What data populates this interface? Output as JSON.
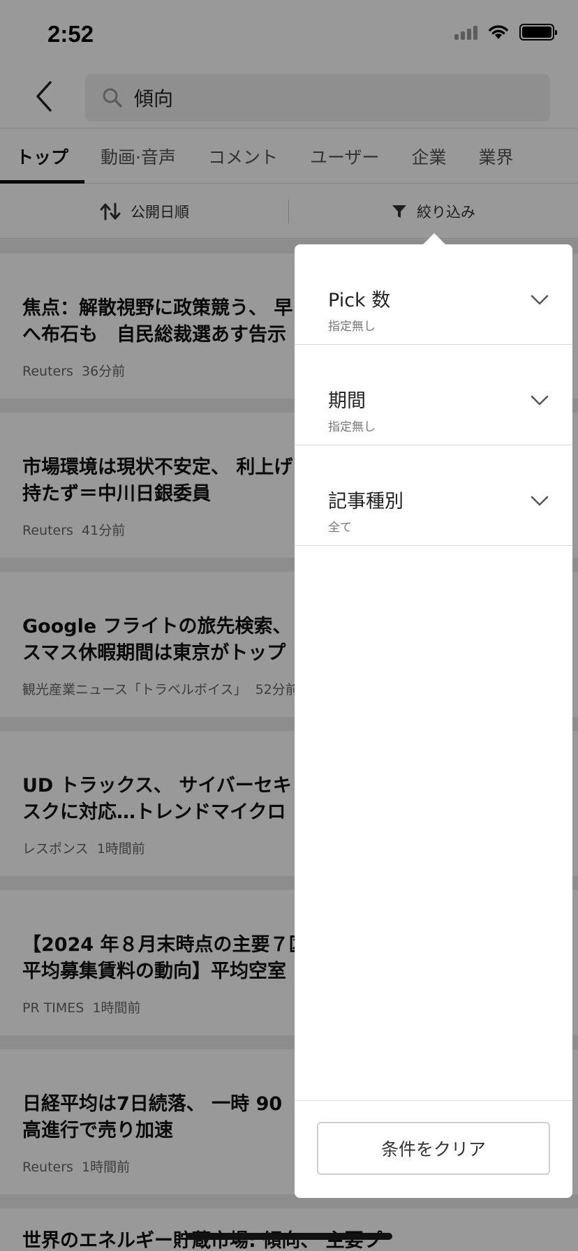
{
  "status_bar": {
    "time": "2:52"
  },
  "search": {
    "query": "傾向"
  },
  "tabs": [
    {
      "label": "トップ",
      "active": true
    },
    {
      "label": "動画·音声",
      "active": false
    },
    {
      "label": "コメント",
      "active": false
    },
    {
      "label": "ユーザー",
      "active": false
    },
    {
      "label": "企業",
      "active": false
    },
    {
      "label": "業界",
      "active": false
    }
  ],
  "sort_bar": {
    "sort_label": "公開日順",
    "filter_label": "絞り込み"
  },
  "articles": [
    {
      "title": "焦点：解散視野に政策競う、 早\nへ布石も　自民総裁選あす告示",
      "source": "Reuters",
      "time": "36分前"
    },
    {
      "title": "市場環境は現状不安定、 利上げ\n持たず＝中川日銀委員",
      "source": "Reuters",
      "time": "41分前"
    },
    {
      "title": "Google フライトの旅先検索、\nスマス休暇期間は東京がトップ",
      "source": "観光産業ニュース「トラベルボイス」",
      "time": "52分前"
    },
    {
      "title": "UD トラックス、 サイバーセキ\nスクに対応…トレンドマイクロ",
      "source": "レスポンス",
      "time": "1時間前"
    },
    {
      "title": "【2024 年８月末時点の主要７区\n平均募集賃料の動向】平均空室",
      "source": "PR TIMES",
      "time": "1時間前"
    },
    {
      "title": "日経平均は7日続落、 一時 90\n高進行で売り加速",
      "source": "Reuters",
      "time": "1時間前"
    },
    {
      "title": "世界のエネルギー貯蔵市場: 傾向、 主要プ",
      "source": "",
      "time": ""
    }
  ],
  "filter_panel": {
    "rows": [
      {
        "title": "Pick 数",
        "value": "指定無し"
      },
      {
        "title": "期間",
        "value": "指定無し"
      },
      {
        "title": "記事種別",
        "value": "全て"
      }
    ],
    "clear_label": "条件をクリア"
  }
}
